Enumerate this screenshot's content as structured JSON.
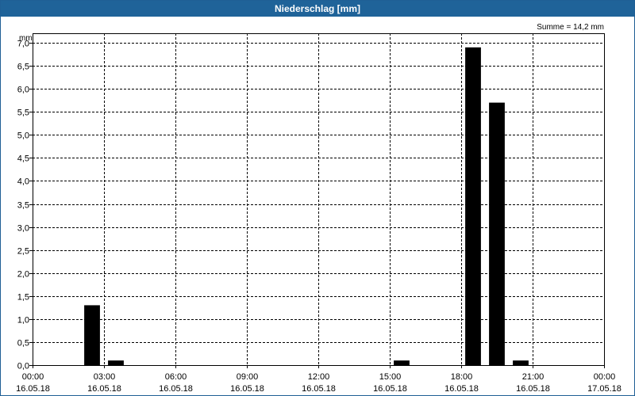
{
  "chart_data": {
    "type": "bar",
    "title": "Niederschlag [mm]",
    "unit": "mm",
    "annotation": "Summe = 14,2 mm",
    "ylim": [
      0,
      7.0
    ],
    "yticks": [
      "0,0",
      "0,5",
      "1,0",
      "1,5",
      "2,0",
      "2,5",
      "3,0",
      "3,5",
      "4,0",
      "4,5",
      "5,0",
      "5,5",
      "6,0",
      "6,5",
      "7,0"
    ],
    "xrange_hours": [
      0,
      24
    ],
    "xticks": [
      {
        "time": "00:00",
        "date": "16.05.18"
      },
      {
        "time": "03:00",
        "date": "16.05.18"
      },
      {
        "time": "06:00",
        "date": "16.05.18"
      },
      {
        "time": "09:00",
        "date": "16.05.18"
      },
      {
        "time": "12:00",
        "date": "16.05.18"
      },
      {
        "time": "15:00",
        "date": "16.05.18"
      },
      {
        "time": "18:00",
        "date": "16.05.18"
      },
      {
        "time": "21:00",
        "date": "16.05.18"
      },
      {
        "time": "00:00",
        "date": "17.05.18"
      }
    ],
    "bars": [
      {
        "hour": 2.5,
        "value": 1.3
      },
      {
        "hour": 3.5,
        "value": 0.1
      },
      {
        "hour": 15.5,
        "value": 0.1
      },
      {
        "hour": 18.5,
        "value": 6.9
      },
      {
        "hour": 19.5,
        "value": 5.7
      },
      {
        "hour": 20.5,
        "value": 0.1
      }
    ],
    "bar_color": "#000000",
    "grid": true
  }
}
